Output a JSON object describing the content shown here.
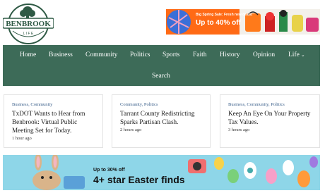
{
  "logo": {
    "text": "BENBROOK",
    "subtext": "L I F E"
  },
  "top_ad": {
    "small_text": "Big Spring Sale: Fresh new deals!",
    "big_text": "Up to 40% off"
  },
  "nav": {
    "items": [
      {
        "label": "Home"
      },
      {
        "label": "Business"
      },
      {
        "label": "Community"
      },
      {
        "label": "Politics"
      },
      {
        "label": "Sports"
      },
      {
        "label": "Faith"
      },
      {
        "label": "History"
      },
      {
        "label": "Opinion"
      },
      {
        "label": "Life"
      }
    ],
    "search_label": "Search"
  },
  "articles": [
    {
      "categories": "Business, Community",
      "title": "TxDOT Wants to Hear from Benbrook: Virtual Public Meeting Set for Today.",
      "time": "1 hour ago"
    },
    {
      "categories": "Community, Politics",
      "title": "Tarrant County Redistricting Sparks Partisan Clash.",
      "time": "2 hours ago"
    },
    {
      "categories": "Business, Community, Politics",
      "title": "Keep An Eye On Your Property Tax Values.",
      "time": "3 hours ago"
    }
  ],
  "bottom_ad": {
    "small_text": "Up to 30% off",
    "big_text": "4+ star Easter finds"
  },
  "colors": {
    "nav_bg": "#3d6b58",
    "category_link": "#3a5f8a",
    "logo_green": "#2f5a45"
  }
}
